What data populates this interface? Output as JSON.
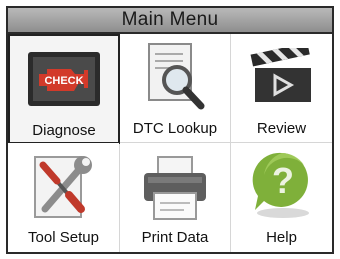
{
  "header": {
    "title": "Main Menu"
  },
  "menu": {
    "items": [
      {
        "label": "Diagnose",
        "icon": "check-engine-icon",
        "selected": true
      },
      {
        "label": "DTC Lookup",
        "icon": "document-magnifier-icon",
        "selected": false
      },
      {
        "label": "Review",
        "icon": "clapperboard-icon",
        "selected": false
      },
      {
        "label": "Tool Setup",
        "icon": "wrench-screwdriver-icon",
        "selected": false
      },
      {
        "label": "Print Data",
        "icon": "printer-icon",
        "selected": false
      },
      {
        "label": "Help",
        "icon": "question-bubble-icon",
        "selected": false
      }
    ]
  },
  "icons": {
    "check_text": "CHECK",
    "help_glyph": "?"
  },
  "colors": {
    "check_badge": "#d23a2a",
    "help_bubble": "#7fb03a",
    "title_bar": "#a3a3a3"
  }
}
